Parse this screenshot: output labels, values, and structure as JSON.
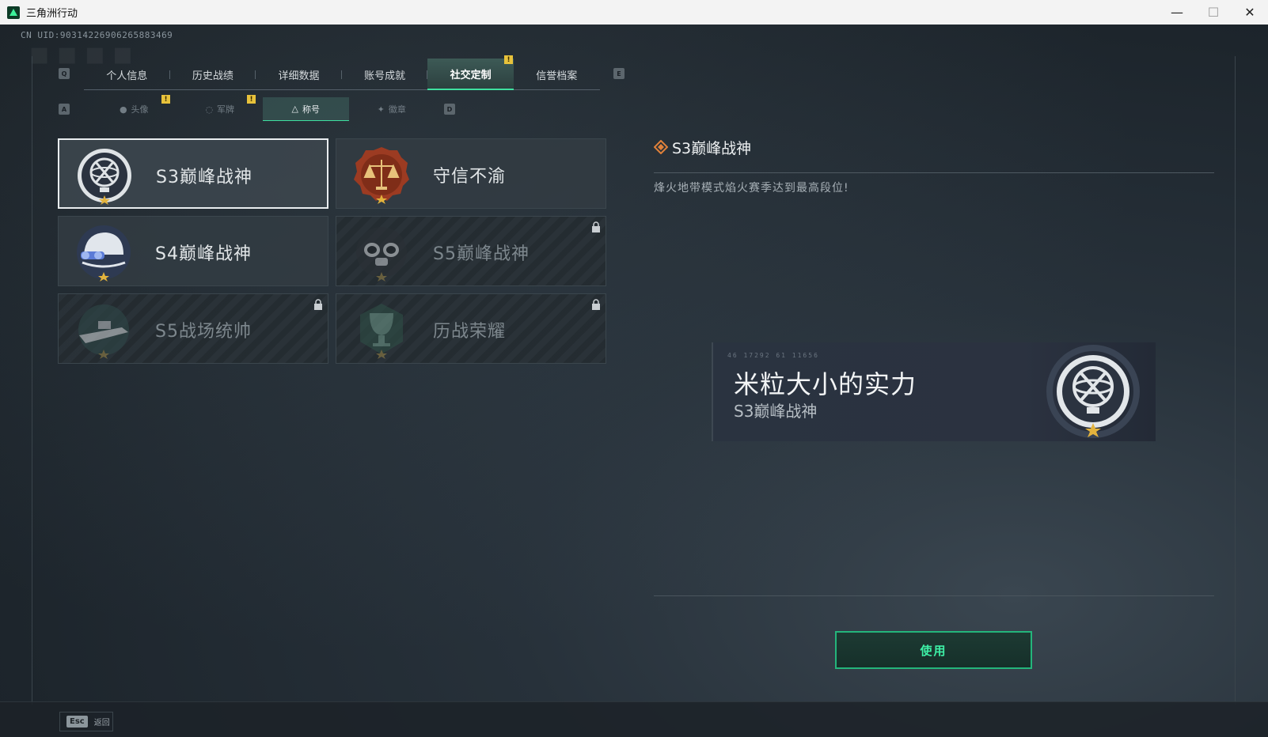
{
  "window": {
    "title": "三角洲行动",
    "minimize": "—",
    "maximize": "☐",
    "close": "✕"
  },
  "uid": "CN UID:9031422690626588346​9",
  "key_hints": {
    "tab_prev": "Q",
    "tab_next": "E",
    "sub_prev": "A",
    "sub_next": "D"
  },
  "tabs": [
    {
      "label": "个人信息",
      "active": false
    },
    {
      "label": "历史战绩",
      "active": false
    },
    {
      "label": "详细数据",
      "active": false
    },
    {
      "label": "账号成就",
      "active": false
    },
    {
      "label": "社交定制",
      "active": true,
      "badge": "!"
    },
    {
      "label": "信誉档案",
      "active": false
    }
  ],
  "subtabs": [
    {
      "label": "头像",
      "icon": "person-icon",
      "badge": "!"
    },
    {
      "label": "军牌",
      "icon": "dogtag-icon",
      "badge": "!"
    },
    {
      "label": "称号",
      "icon": "title-icon",
      "active": true
    },
    {
      "label": "徽章",
      "icon": "badge-icon"
    }
  ],
  "cards": [
    {
      "label": "S3巅峰战神",
      "selected": true,
      "locked": false,
      "emblem": "armillary-emblem"
    },
    {
      "label": "守信不渝",
      "selected": false,
      "locked": false,
      "emblem": "scales-emblem"
    },
    {
      "label": "S4巅峰战神",
      "selected": false,
      "locked": false,
      "emblem": "helmet-emblem"
    },
    {
      "label": "S5巅峰战神",
      "selected": false,
      "locked": true,
      "emblem": "gasmask-emblem"
    },
    {
      "label": "S5战场统帅",
      "selected": false,
      "locked": true,
      "emblem": "boat-emblem"
    },
    {
      "label": "历战荣耀",
      "selected": false,
      "locked": true,
      "emblem": "trophy-emblem"
    }
  ],
  "detail": {
    "title": "S3巅峰战神",
    "description": "烽火地带模式焰火赛季达到最高段位!"
  },
  "preview": {
    "code": "46 17292  61 11656",
    "player_name": "米粒大小的实力",
    "title": "S3巅峰战神"
  },
  "use_button": "使用",
  "footer": {
    "esc_key": "Esc",
    "esc_label": "返回"
  },
  "colors": {
    "accent": "#3ee0a0",
    "badge": "#e8c23b",
    "detail_icon": "#e0813a"
  }
}
